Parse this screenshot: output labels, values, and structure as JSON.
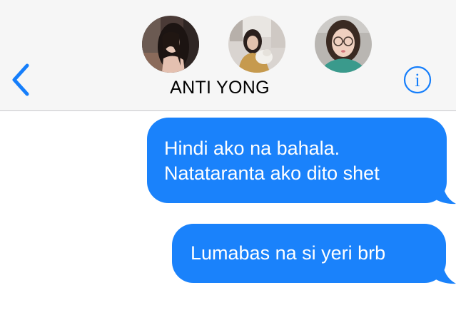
{
  "header": {
    "contact_name": "ANTI YONG",
    "back_icon": "chevron-left-icon",
    "info_icon": "info-icon",
    "avatars": [
      {
        "name": "avatar-1"
      },
      {
        "name": "avatar-2"
      },
      {
        "name": "avatar-3"
      }
    ]
  },
  "messages": [
    {
      "line1": "Hindi ako na bahala.",
      "line2": "Natataranta ako dito shet"
    },
    {
      "line1": "Lumabas na si yeri brb"
    }
  ],
  "colors": {
    "accent": "#157efb",
    "bubble": "#1a82fb",
    "header_bg": "#f6f6f6"
  }
}
